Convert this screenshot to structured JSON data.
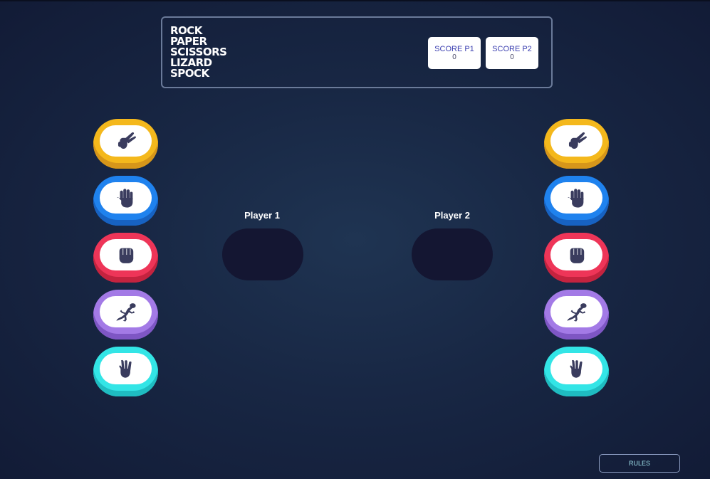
{
  "game": {
    "title_lines": [
      "ROCK",
      "PAPER",
      "SCISSORS",
      "LIZARD",
      "SPOCK"
    ]
  },
  "scores": {
    "p1": {
      "label": "SCORE P1",
      "value": "0"
    },
    "p2": {
      "label": "SCORE P2",
      "value": "0"
    }
  },
  "players": {
    "p1": {
      "label": "Player 1"
    },
    "p2": {
      "label": "Player 2"
    }
  },
  "choices": [
    {
      "id": "scissors",
      "icon": "scissors-hand-icon",
      "color": "#f4b81c"
    },
    {
      "id": "paper",
      "icon": "paper-hand-icon",
      "color": "#1f82ee"
    },
    {
      "id": "rock",
      "icon": "rock-fist-icon",
      "color": "#ee3558"
    },
    {
      "id": "lizard",
      "icon": "lizard-icon",
      "color": "#a37ae6"
    },
    {
      "id": "spock",
      "icon": "spock-hand-icon",
      "color": "#33e5e6"
    }
  ],
  "rules_button": {
    "label": "RULES"
  },
  "colors": {
    "background": "#182744",
    "icon": "#3a3c5e",
    "pick_slot": "#141632",
    "score_label": "#3b3fb0"
  }
}
